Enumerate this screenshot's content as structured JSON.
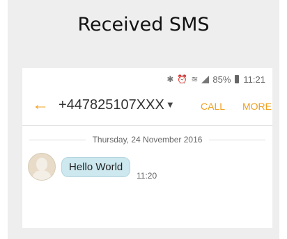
{
  "caption": "Received SMS",
  "status_bar": {
    "icons": [
      "bluetooth-icon",
      "alarm-icon",
      "wifi-icon",
      "signal-icon",
      "battery-icon"
    ],
    "battery": "85%",
    "time": "11:21"
  },
  "header": {
    "back_icon": "back-arrow-icon",
    "contact_number": "+447825107XXX",
    "dropdown_icon": "caret-down-icon",
    "call_label": "CALL",
    "more_label": "MORE"
  },
  "conversation": {
    "date_separator": "Thursday, 24 November 2016",
    "messages": [
      {
        "text": "Hello World",
        "time": "11:20",
        "direction": "incoming"
      }
    ]
  },
  "colors": {
    "accent": "#f0a020",
    "bubble": "#cde8ef",
    "frame": "#eeeeee"
  }
}
